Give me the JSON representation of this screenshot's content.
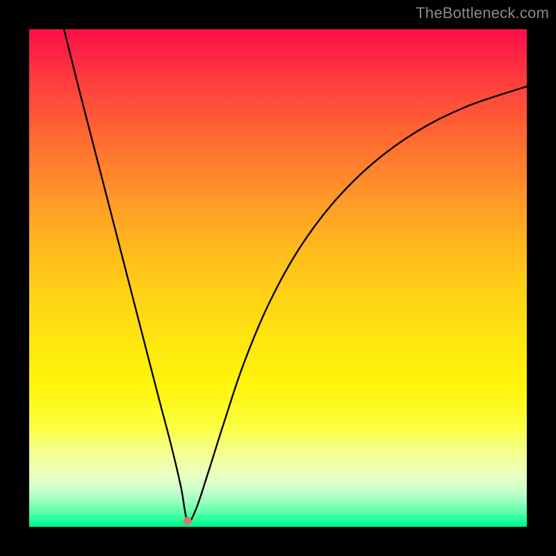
{
  "watermark": "TheBottleneck.com",
  "colors": {
    "gradient_top": "#f80e46",
    "gradient_bottom": "#00ee8c",
    "curve": "#000000",
    "minimum_dot": "#d07a6a",
    "page_bg": "#000000"
  },
  "chart_data": {
    "type": "line",
    "title": "",
    "xlabel": "",
    "ylabel": "",
    "xlim": [
      0,
      100
    ],
    "ylim": [
      0,
      100
    ],
    "grid": false,
    "note": "V-shaped bottleneck curve against a vertical green-to-red gradient. No axis ticks or labels are shown. x/y are read off as percentages of the plot area (0 = bottom/left, 100 = top/right).",
    "series": [
      {
        "name": "bottleneck-curve",
        "x": [
          7,
          10,
          14,
          18,
          22,
          26,
          28.5,
          30.5,
          31.8,
          33.5,
          36,
          39,
          43,
          48,
          54,
          61,
          69,
          78,
          88,
          100
        ],
        "y": [
          100,
          88,
          72.5,
          57,
          41.5,
          26,
          16.5,
          8,
          1.2,
          3.5,
          11,
          20.5,
          32.5,
          44.5,
          55.5,
          65,
          73,
          79.5,
          84.5,
          88.5
        ]
      }
    ],
    "minimum_point": {
      "x": 31.8,
      "y": 1.2
    }
  }
}
